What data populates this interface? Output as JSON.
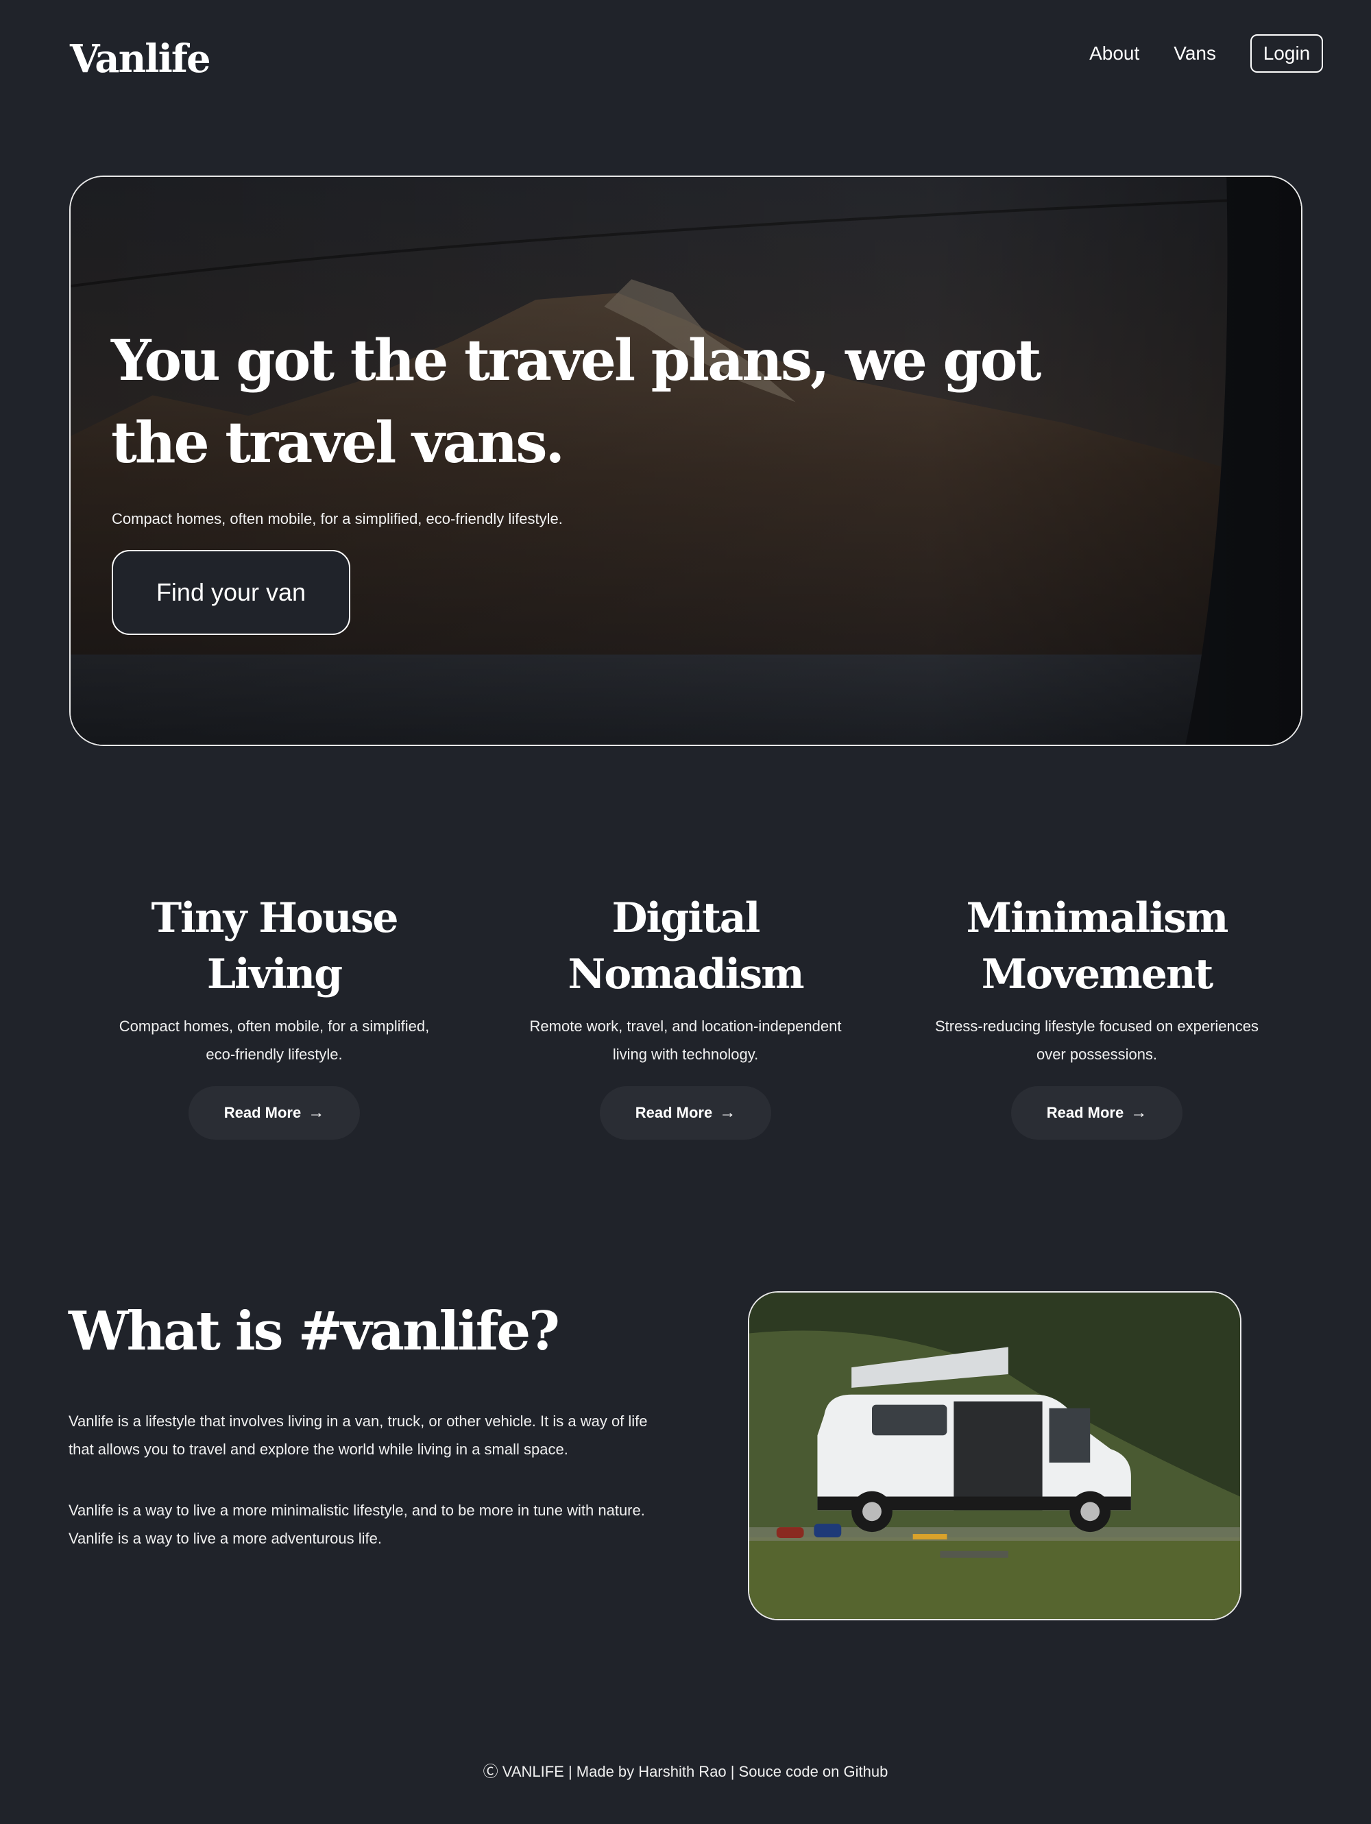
{
  "header": {
    "logo": "Vanlife",
    "nav": {
      "about": "About",
      "vans": "Vans",
      "login": "Login"
    }
  },
  "hero": {
    "title": "You got the travel plans, we got the travel vans.",
    "subtitle": "Compact homes, often mobile, for a simplified, eco-friendly lifestyle.",
    "cta": "Find your van"
  },
  "features": [
    {
      "title": "Tiny House Living",
      "description": "Compact homes, often mobile, for a simplified, eco-friendly lifestyle.",
      "button": "Read More",
      "arrow": "→"
    },
    {
      "title": "Digital Nomadism",
      "description": "Remote work, travel, and location-independent living with technology.",
      "button": "Read More",
      "arrow": "→"
    },
    {
      "title": "Minimalism Movement",
      "description": "Stress-reducing lifestyle focused on experiences over possessions.",
      "button": "Read More",
      "arrow": "→"
    }
  ],
  "about": {
    "title": "What is #vanlife?",
    "paragraph1": "Vanlife is a lifestyle that involves living in a van, truck, or other vehicle. It is a way of life that allows you to travel and explore the world while living in a small space.",
    "paragraph2": "Vanlife is a way to live a more minimalistic lifestyle, and to be more in tune with nature. Vanlife is a way to live a more adventurous life."
  },
  "footer": {
    "text": "Ⓒ VANLIFE | Made by Harshith Rao | Souce code on Github"
  },
  "colors": {
    "background": "#20232a",
    "button_bg": "#2a2d34",
    "text": "#ffffff"
  }
}
